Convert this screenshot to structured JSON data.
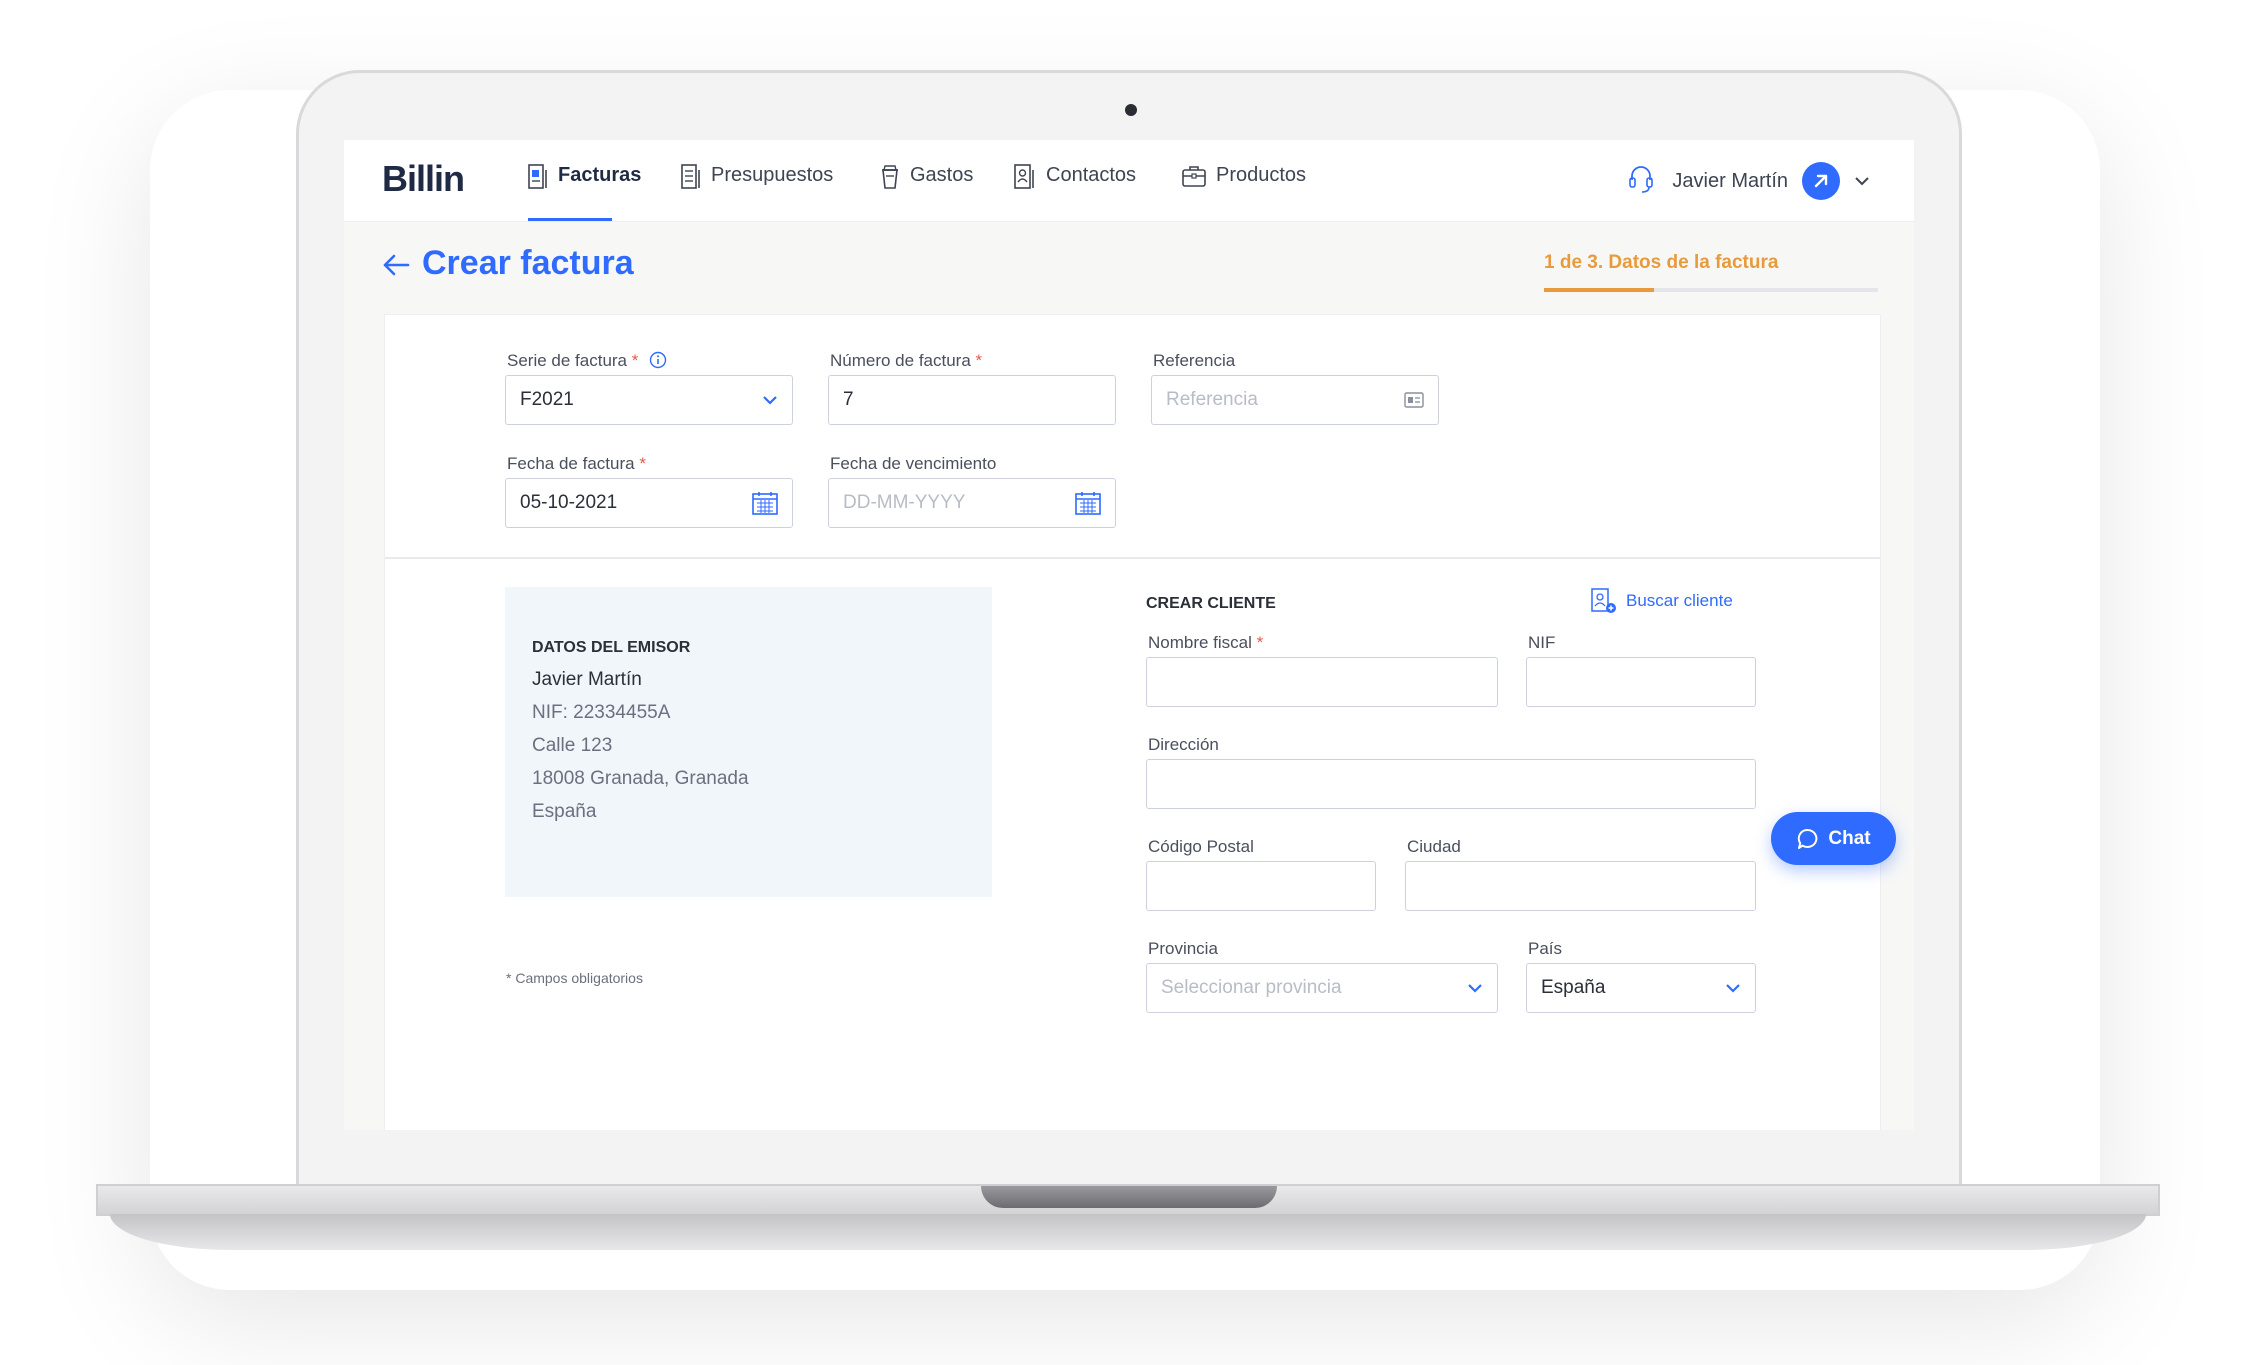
{
  "app": {
    "logo_text": "Billin"
  },
  "nav": {
    "items": [
      {
        "label": "Facturas",
        "icon": "invoice-icon",
        "active": true
      },
      {
        "label": "Presupuestos",
        "icon": "quote-icon",
        "active": false
      },
      {
        "label": "Gastos",
        "icon": "cup-icon",
        "active": false
      },
      {
        "label": "Contactos",
        "icon": "contact-icon",
        "active": false
      },
      {
        "label": "Productos",
        "icon": "briefcase-icon",
        "active": false
      }
    ],
    "user_name": "Javier Martín"
  },
  "header": {
    "title": "Crear factura",
    "step_label": "1 de 3. Datos de la factura",
    "step_progress": 0.33
  },
  "invoice_fields": {
    "serie": {
      "label": "Serie de factura",
      "required_mark": "*",
      "value": "F2021"
    },
    "numero": {
      "label": "Número de factura",
      "required_mark": "*",
      "value": "7"
    },
    "referencia": {
      "label": "Referencia",
      "placeholder": "Referencia"
    },
    "fecha": {
      "label": "Fecha de factura",
      "required_mark": "*",
      "value": "05-10-2021"
    },
    "vencimiento": {
      "label": "Fecha de vencimiento",
      "placeholder": "DD-MM-YYYY"
    }
  },
  "issuer": {
    "title": "DATOS DEL EMISOR",
    "name": "Javier Martín",
    "nif": "NIF: 22334455A",
    "street": "Calle 123",
    "city": "18008 Granada, Granada",
    "country": "España"
  },
  "client": {
    "section_title": "CREAR CLIENTE",
    "search_label": "Buscar cliente",
    "nombre_fiscal": {
      "label": "Nombre fiscal",
      "required_mark": "*"
    },
    "nif": {
      "label": "NIF"
    },
    "direccion": {
      "label": "Dirección"
    },
    "codigo_postal": {
      "label": "Código Postal"
    },
    "ciudad": {
      "label": "Ciudad"
    },
    "provincia": {
      "label": "Provincia",
      "placeholder": "Seleccionar provincia"
    },
    "pais": {
      "label": "País",
      "value": "España"
    }
  },
  "footer": {
    "required_note": "* Campos obligatorios"
  },
  "chat": {
    "label": "Chat"
  },
  "colors": {
    "accent": "#2f6bff",
    "step": "#e89b3c",
    "required": "#e55b4d"
  }
}
